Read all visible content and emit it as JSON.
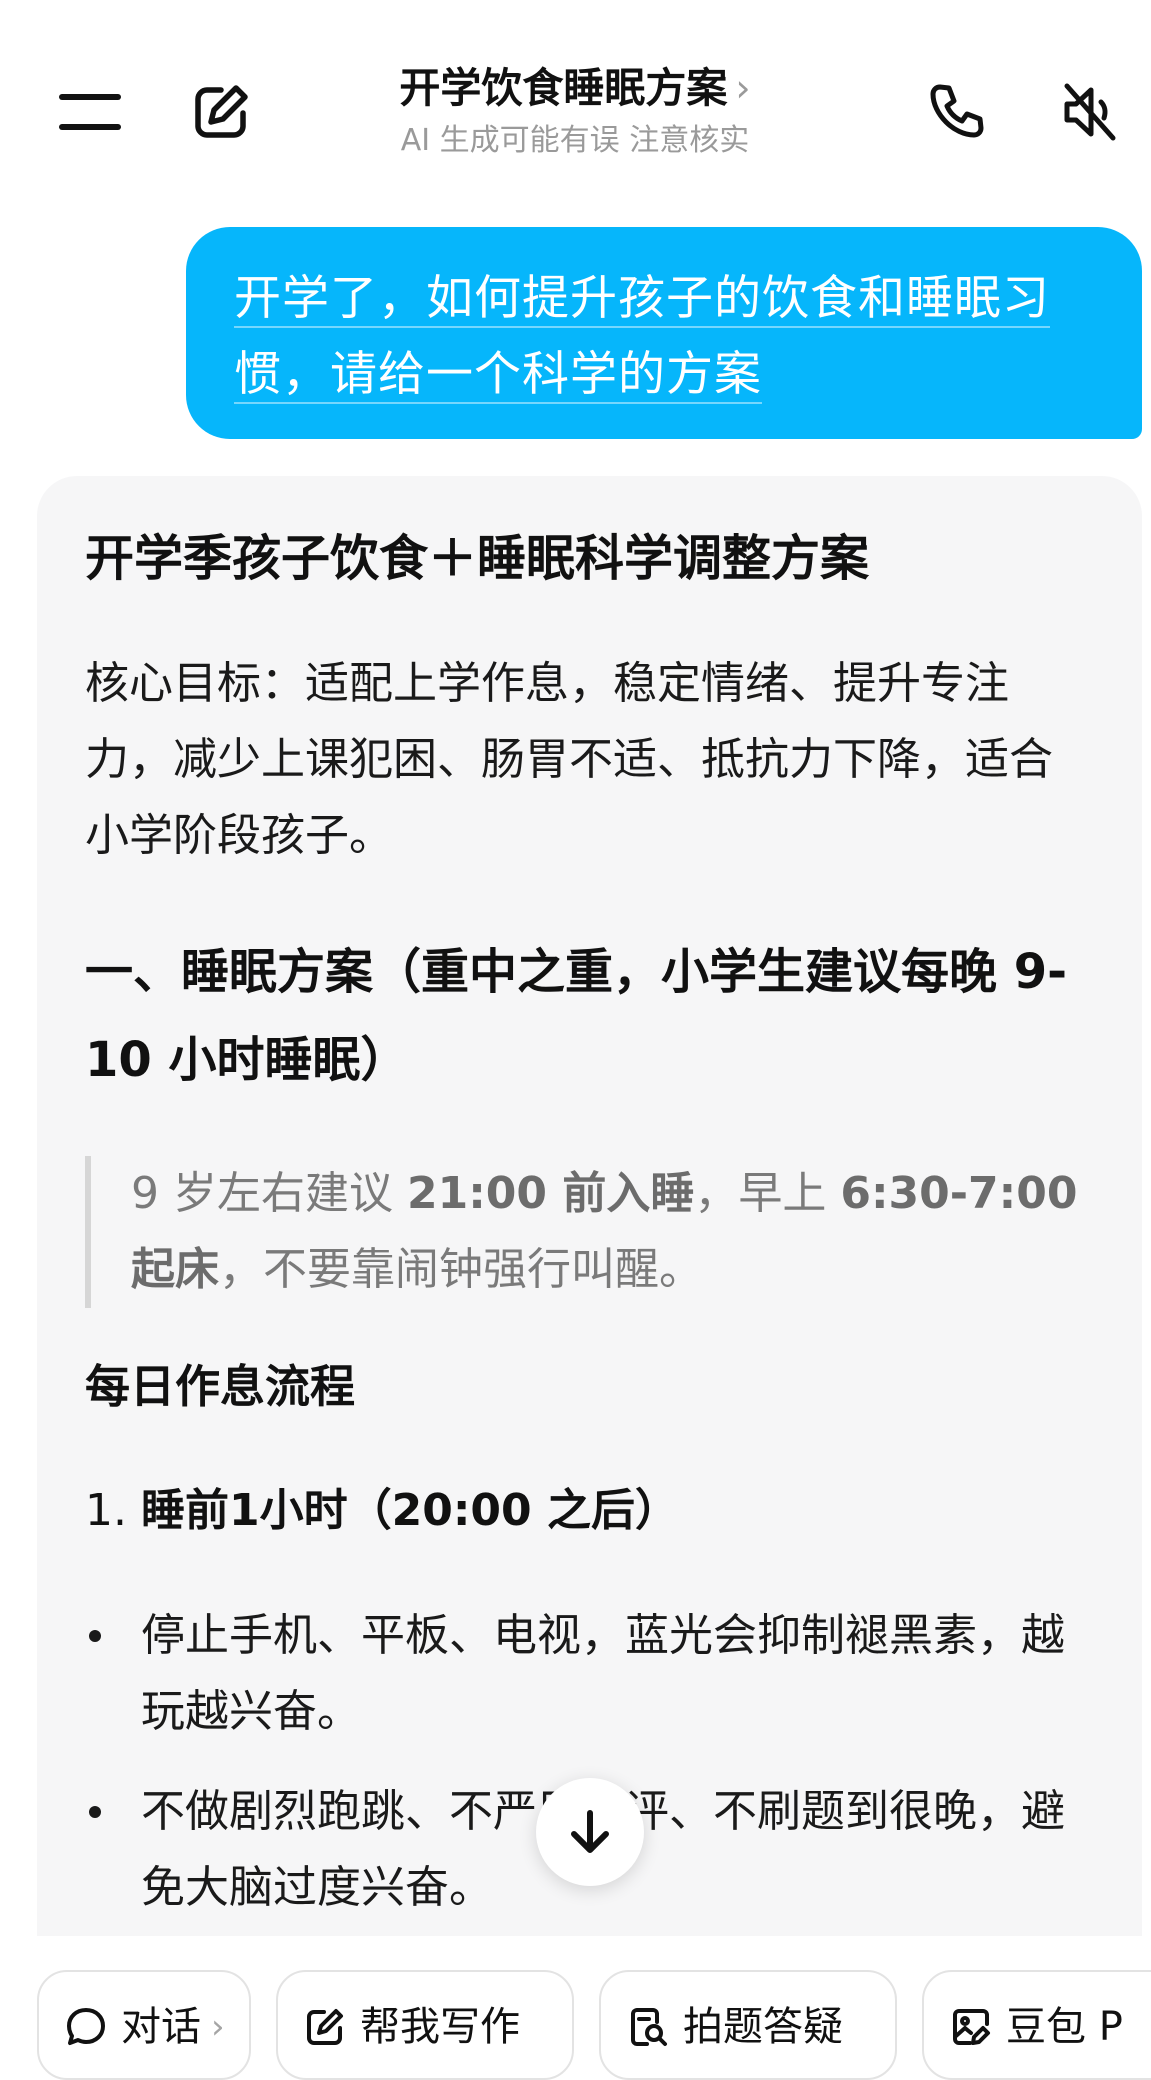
{
  "header": {
    "title": "开学饮食睡眠方案",
    "title_chevron": "›",
    "subtitle": "AI 生成可能有误 注意核实"
  },
  "icons": {
    "menu": "menu-icon",
    "compose": "compose-icon",
    "call": "phone-icon",
    "mute": "speaker-mute-icon",
    "scroll": "arrow-down-icon",
    "chat": "chat-bubble-icon",
    "write": "edit-icon",
    "photo": "document-search-icon",
    "doubao": "image-edit-icon"
  },
  "user_message": {
    "line1": "开学了，如何提升孩子的饮食和睡眠习",
    "line2": "惯，请给一个科学的方案"
  },
  "ai_message": {
    "title": "开学季孩子饮食＋睡眠科学调整方案",
    "goal": "核心目标：适配上学作息，稳定情绪、提升专注力，减少上课犯困、肠胃不适、抵抗力下降，适合小学阶段孩子。",
    "section_title": "一、睡眠方案（重中之重，小学生建议每晚 9-10 小时睡眠）",
    "quote": {
      "p1": "9 岁左右建议 ",
      "b1": "21:00 前入睡",
      "p2": "，早上 ",
      "b2": "6:30-7:00 起床",
      "p3": "，不要靠闹钟强行叫醒。"
    },
    "subsection_title": "每日作息流程",
    "step_number": "1.",
    "step_text": "睡前1小时（20:00 之后）",
    "bullets": [
      "停止手机、平板、电视，蓝光会抑制褪黑素，越玩越兴奋。",
      "不做剧烈跑跳、不严厉批评、不刷题到很晚，避免大脑过度兴奋。"
    ]
  },
  "quick_actions": {
    "chat": "对话",
    "chat_chevron": "›",
    "write": "帮我写作",
    "photo": "拍题答疑",
    "doubao": "豆包 P"
  },
  "colors": {
    "user_bubble": "#06b6fb",
    "ai_card": "#f6f6f7",
    "muted_text": "#9a9a9a"
  }
}
